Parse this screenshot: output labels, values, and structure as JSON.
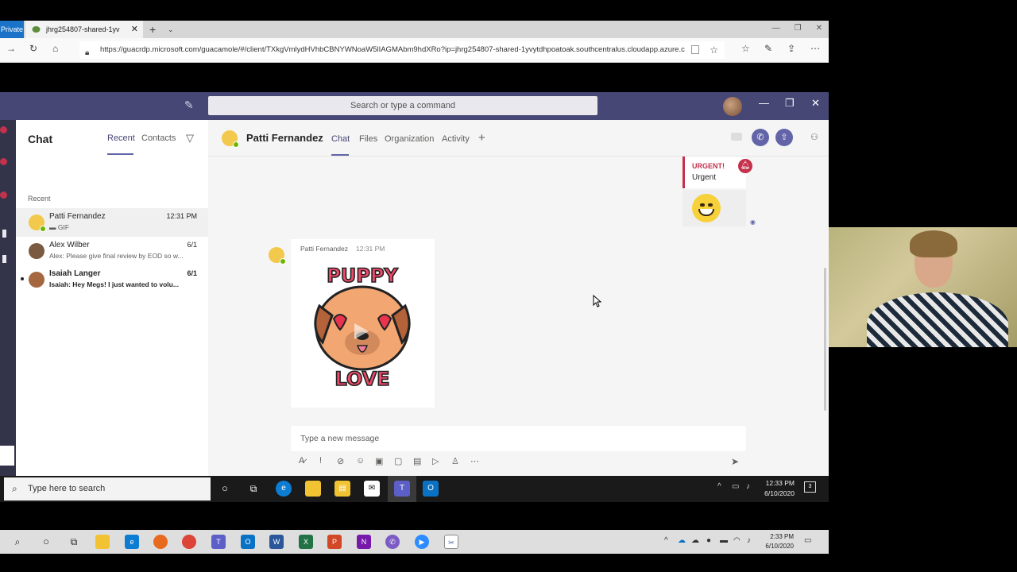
{
  "browser": {
    "private_label": "Private",
    "tab_title": "jhrg254807-shared-1yv",
    "url": "https://guacrdp.microsoft.com/guacamole/#/client/TXkgVmlydHVhbCBNYWNoaW5lIAGMAbm9hdXRo?ip=jhrg254807-shared-1yvytdhpoatoak.southcentralus.cloudapp.azure.c"
  },
  "teams": {
    "search_placeholder": "Search or type a command",
    "chat_list": {
      "title": "Chat",
      "tabs": [
        "Recent",
        "Contacts"
      ],
      "section": "Recent",
      "items": [
        {
          "name": "Patti Fernandez",
          "preview": "GIF",
          "time": "12:31 PM",
          "unread": false
        },
        {
          "name": "Alex Wilber",
          "preview": "Alex: Please give final review by EOD so w...",
          "time": "6/1",
          "unread": false
        },
        {
          "name": "Isaiah Langer",
          "preview": "Isaiah: Hey Megs! I just wanted to volu...",
          "time": "6/1",
          "unread": true
        }
      ]
    },
    "conversation": {
      "name": "Patti Fernandez",
      "tabs": [
        "Chat",
        "Files",
        "Organization",
        "Activity"
      ],
      "urgent": {
        "label": "URGENT!",
        "text": "Urgent"
      },
      "message": {
        "sender": "Patti Fernandez",
        "time": "12:31 PM",
        "gif_top": "PUPPY",
        "gif_bottom": "LOVE"
      },
      "compose_placeholder": "Type a new message"
    }
  },
  "inner_taskbar": {
    "search_placeholder": "Type here to search",
    "time": "12:33 PM",
    "date": "6/10/2020",
    "notification_count": "3"
  },
  "outer_taskbar": {
    "time": "2:33 PM",
    "date": "6/10/2020"
  },
  "colors": {
    "teams_purple": "#464775",
    "accent": "#6264a7",
    "urgent_red": "#c4314b",
    "presence_green": "#6bb700"
  }
}
